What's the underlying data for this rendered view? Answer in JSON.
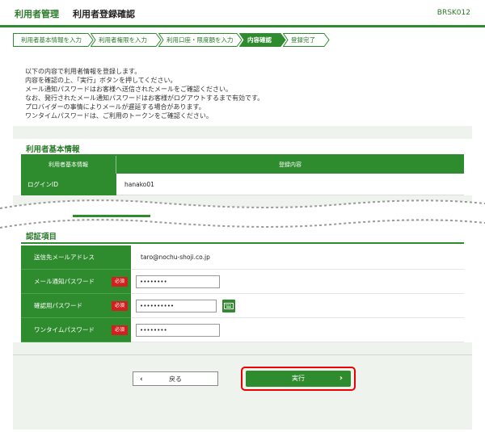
{
  "header": {
    "section": "利用者管理",
    "title": "利用者登録確認",
    "screen_code": "BRSK012"
  },
  "steps": [
    {
      "label": "利用者基本情報を入力",
      "state": "done"
    },
    {
      "label": "利用者権限を入力",
      "state": "done"
    },
    {
      "label": "利用口座・限度額を入力",
      "state": "done"
    },
    {
      "label": "内容確認",
      "state": "active"
    },
    {
      "label": "登録完了",
      "state": "pending"
    }
  ],
  "intro": [
    "以下の内容で利用者情報を登録します。",
    "内容を確認の上、「実行」ボタンを押してください。",
    "メール通知パスワードはお客様へ送信されたメールをご確認ください。",
    "なお、発行されたメール通知パスワードはお客様がログアウトするまで有効です。",
    "プロバイダーの事情によりメールが遅延する場合があります。",
    "ワンタイムパスワードは、ご利用のトークンをご確認ください。"
  ],
  "basic_info": {
    "title": "利用者基本情報",
    "col_label": "利用者基本情報",
    "col_value": "登録内容",
    "login_id_label": "ログインID",
    "login_id_value": "hanako01"
  },
  "auth": {
    "title": "認証項目",
    "email_label": "送信先メールアドレス",
    "email_value": "taro@nochu-shoji.co.jp",
    "required_badge": "必須",
    "mail_pw_label": "メール通知パスワード",
    "mail_pw_value": "••••••••",
    "confirm_pw_label": "確認用パスワード",
    "confirm_pw_value": "••••••••••",
    "otp_label": "ワンタイムパスワード",
    "otp_value": "••••••••"
  },
  "buttons": {
    "back": "戻る",
    "execute": "実行"
  },
  "colors": {
    "accent": "#2e8b2e",
    "required": "#d02020",
    "highlight": "#e00000"
  }
}
